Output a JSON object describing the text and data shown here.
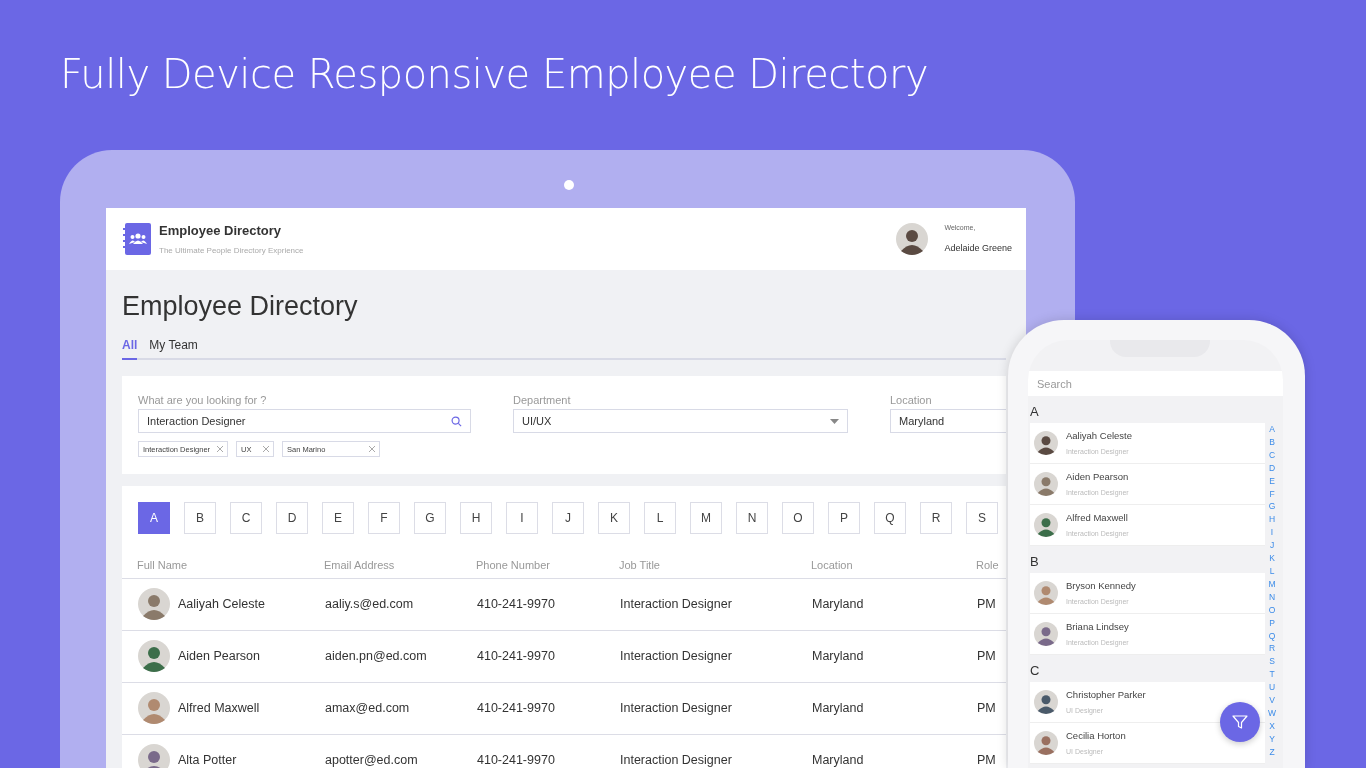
{
  "headline": "Fully Device Responsive Employee Directory",
  "tablet": {
    "app_header": {
      "title": "Employee Directory",
      "subtitle": "The Ultimate People Directory Exprience",
      "welcome": "Welcome,",
      "user": "Adelaide Greene"
    },
    "page_title": "Employee Directory",
    "tabs": [
      {
        "label": "All",
        "selected": true
      },
      {
        "label": "My Team",
        "selected": false
      }
    ],
    "filters": {
      "search": {
        "label": "What are you looking for ?",
        "value": "Interaction Designer"
      },
      "department": {
        "label": "Department",
        "value": "UI/UX"
      },
      "location": {
        "label": "Location",
        "value": "Maryland"
      },
      "chips": [
        "Interaction Designer",
        "UX",
        "San Marino"
      ]
    },
    "letters": [
      {
        "label": "A",
        "selected": true
      },
      {
        "label": "B",
        "selected": false
      },
      {
        "label": "C",
        "selected": false
      },
      {
        "label": "D",
        "selected": false
      },
      {
        "label": "E",
        "selected": false
      },
      {
        "label": "F",
        "selected": false
      },
      {
        "label": "G",
        "selected": false
      },
      {
        "label": "H",
        "selected": false
      },
      {
        "label": "I",
        "selected": false
      },
      {
        "label": "J",
        "selected": false
      },
      {
        "label": "K",
        "selected": false
      },
      {
        "label": "L",
        "selected": false
      },
      {
        "label": "M",
        "selected": false
      },
      {
        "label": "N",
        "selected": false
      },
      {
        "label": "O",
        "selected": false
      },
      {
        "label": "P",
        "selected": false
      },
      {
        "label": "Q",
        "selected": false
      },
      {
        "label": "R",
        "selected": false
      },
      {
        "label": "S",
        "selected": false
      }
    ],
    "table": {
      "columns": [
        "Full Name",
        "Email Address",
        "Phone Number",
        "Job Title",
        "Location",
        "Role"
      ],
      "rows": [
        {
          "name": "Aaliyah Celeste",
          "email": "aaliy.s@ed.com",
          "phone": "410-241-9970",
          "job_title": "Interaction Designer",
          "location": "Maryland",
          "role": "PM"
        },
        {
          "name": "Aiden Pearson",
          "email": "aiden.pn@ed.com",
          "phone": "410-241-9970",
          "job_title": "Interaction Designer",
          "location": "Maryland",
          "role": "PM"
        },
        {
          "name": "Alfred Maxwell",
          "email": "amax@ed.com",
          "phone": "410-241-9970",
          "job_title": "Interaction Designer",
          "location": "Maryland",
          "role": "PM"
        },
        {
          "name": "Alta Potter",
          "email": "apotter@ed.com",
          "phone": "410-241-9970",
          "job_title": "Interaction Designer",
          "location": "Maryland",
          "role": "PM"
        }
      ]
    }
  },
  "phone": {
    "search": {
      "placeholder": "Search"
    },
    "sections": [
      {
        "letter": "A",
        "people": [
          {
            "name": "Aaliyah Celeste",
            "title": "Interaction Designer"
          },
          {
            "name": "Aiden Pearson",
            "title": "Interaction Designer"
          },
          {
            "name": "Alfred Maxwell",
            "title": "Interaction Designer"
          }
        ]
      },
      {
        "letter": "B",
        "people": [
          {
            "name": "Bryson Kennedy",
            "title": "Interaction Designer"
          },
          {
            "name": "Briana Lindsey",
            "title": "Interaction Designer"
          }
        ]
      },
      {
        "letter": "C",
        "people": [
          {
            "name": "Christopher Parker",
            "title": "UI Designer"
          },
          {
            "name": "Cecilia Horton",
            "title": "UI Designer"
          }
        ]
      }
    ],
    "index": [
      "A",
      "B",
      "C",
      "D",
      "E",
      "F",
      "G",
      "H",
      "I",
      "J",
      "K",
      "L",
      "M",
      "N",
      "O",
      "P",
      "Q",
      "R",
      "S",
      "T",
      "U",
      "V",
      "W",
      "X",
      "Y",
      "Z"
    ]
  }
}
